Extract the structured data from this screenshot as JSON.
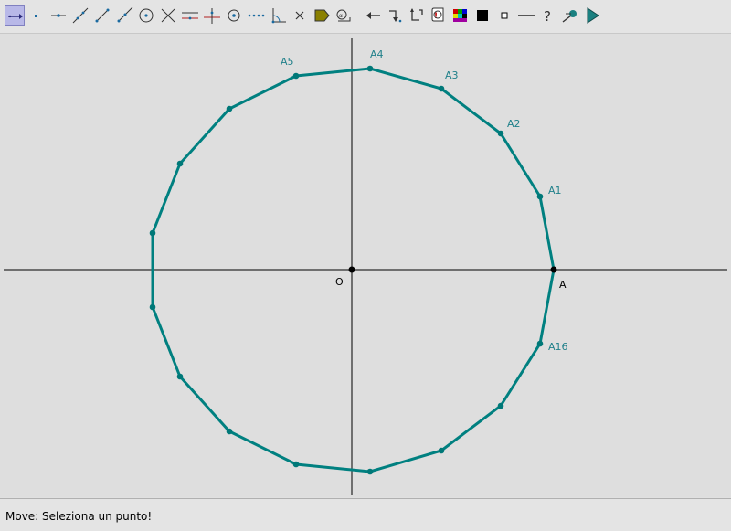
{
  "toolbar": {
    "tools": [
      {
        "name": "move-tool",
        "icon": "move-arrow-icon",
        "selected": true
      },
      {
        "name": "point-tool",
        "icon": "point-icon"
      },
      {
        "name": "point-on-object-tool",
        "icon": "point-on-line-icon"
      },
      {
        "name": "line-tool",
        "icon": "line-icon"
      },
      {
        "name": "segment-tool",
        "icon": "segment-icon"
      },
      {
        "name": "ray-tool",
        "icon": "ray-icon"
      },
      {
        "name": "circle-tool",
        "icon": "circle-icon"
      },
      {
        "name": "intersection-tool",
        "icon": "intersection-icon"
      },
      {
        "name": "parallel-tool",
        "icon": "parallel-line-icon"
      },
      {
        "name": "perpendicular-tool",
        "icon": "perpendicular-line-icon"
      },
      {
        "name": "midpoint-tool",
        "icon": "midpoint-circle-icon"
      },
      {
        "name": "locus-tool",
        "icon": "dotted-locus-icon"
      },
      {
        "name": "angle-tool",
        "icon": "angle-icon"
      },
      {
        "name": "delete-tool",
        "icon": "delete-x-icon"
      },
      {
        "name": "fill-tool",
        "icon": "fill-bucket-icon"
      },
      {
        "name": "measure-tool",
        "icon": "measure-icon"
      },
      {
        "name": "undo-tool",
        "icon": "undo-arrow-icon"
      },
      {
        "name": "redo-tool",
        "icon": "redo-arrow-icon"
      },
      {
        "name": "transform-tool",
        "icon": "transform-arrows-icon"
      },
      {
        "name": "macro-tool",
        "icon": "macro-icon"
      },
      {
        "name": "color-tool",
        "icon": "color-palette-icon"
      },
      {
        "name": "black-square-tool",
        "icon": "filled-square-icon"
      },
      {
        "name": "small-square-tool",
        "icon": "small-square-icon"
      },
      {
        "name": "line-style-tool",
        "icon": "line-style-icon"
      },
      {
        "name": "help-tool",
        "icon": "question-icon"
      },
      {
        "name": "hide-tool",
        "icon": "hide-icon"
      },
      {
        "name": "play-tool",
        "icon": "play-triangle-icon"
      }
    ]
  },
  "colors": {
    "polygon": "#008080",
    "point": "#007878",
    "label": "#20808a",
    "axis": "#000000",
    "selected_tool_bg": "#b8b8e8",
    "canvas_bg": "#dedede"
  },
  "canvas": {
    "origin_label": "O",
    "point_A_label": "A",
    "vertex_labels": [
      "A1",
      "A2",
      "A3",
      "A4",
      "A5",
      "A16"
    ]
  },
  "status": {
    "text": "Move: Seleziona un punto!"
  }
}
